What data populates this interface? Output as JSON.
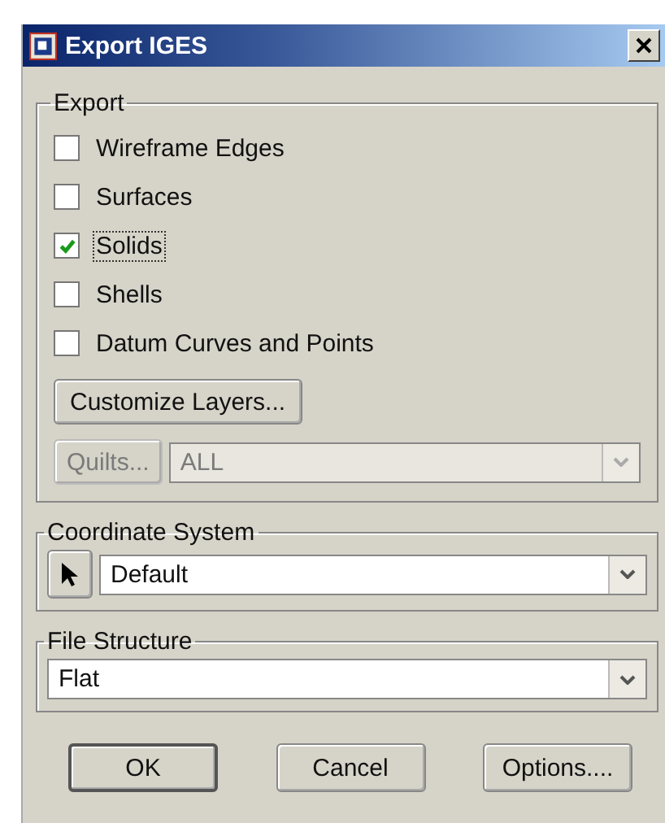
{
  "window": {
    "title": "Export IGES"
  },
  "export": {
    "label": "Export",
    "options": [
      {
        "label": "Wireframe Edges",
        "checked": false,
        "focused": false
      },
      {
        "label": "Surfaces",
        "checked": false,
        "focused": false
      },
      {
        "label": "Solids",
        "checked": true,
        "focused": true
      },
      {
        "label": "Shells",
        "checked": false,
        "focused": false
      },
      {
        "label": "Datum Curves and Points",
        "checked": false,
        "focused": false
      }
    ],
    "customize_button": "Customize Layers...",
    "quilts_button": {
      "label": "Quilts...",
      "disabled": true
    },
    "quilts_dropdown": {
      "value": "ALL",
      "disabled": true
    }
  },
  "coordinate_system": {
    "label": "Coordinate System",
    "value": "Default"
  },
  "file_structure": {
    "label": "File Structure",
    "value": "Flat"
  },
  "buttons": [
    {
      "label": "OK",
      "default": true
    },
    {
      "label": "Cancel",
      "default": false
    },
    {
      "label": "Options....",
      "default": false
    }
  ]
}
